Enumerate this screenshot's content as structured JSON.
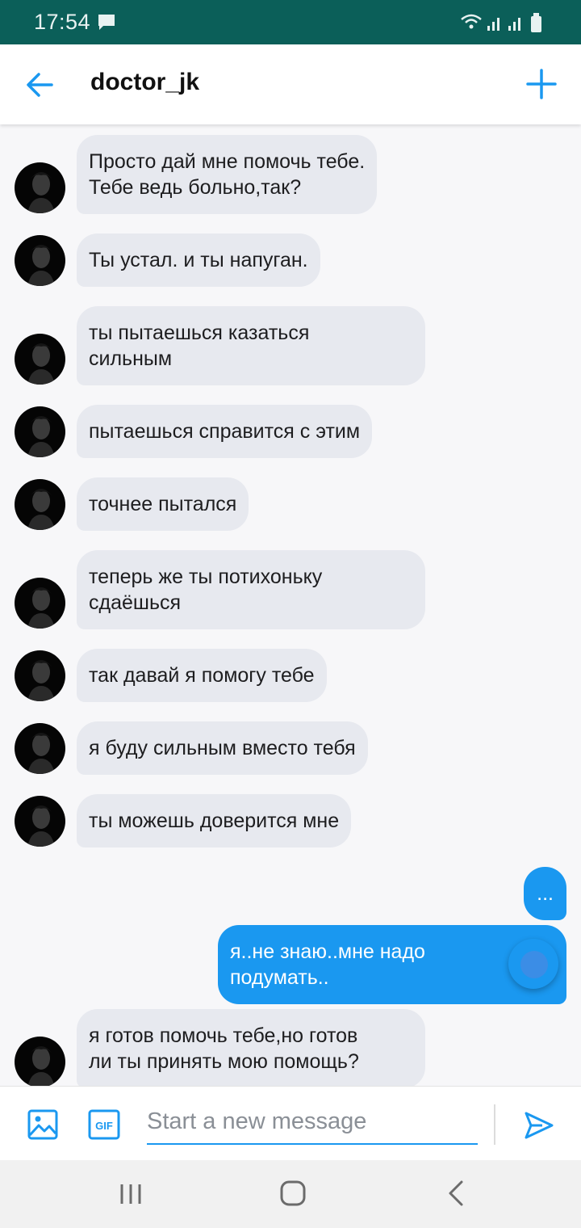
{
  "status_bar": {
    "time": "17:54"
  },
  "header": {
    "title": "doctor_jk"
  },
  "messages": [
    {
      "line1": "Просто дай мне помочь тебе.",
      "line2": "Тебе ведь больно,так?"
    },
    {
      "line1": "Ты устал. и ты напуган."
    },
    {
      "line1": "ты пытаешься казаться",
      "line2": "сильным"
    },
    {
      "line1": "пытаешься справится с этим"
    },
    {
      "line1": "точнее пытался"
    },
    {
      "line1": "теперь же ты потихоньку",
      "line2": "сдаёшься"
    },
    {
      "line1": "так давай я помогу тебе"
    },
    {
      "line1": "я буду сильным вместо тебя"
    },
    {
      "line1": "ты можешь доверится мне"
    },
    {
      "line1": "..."
    },
    {
      "line1": "я..не знаю..мне надо",
      "line2": "подумать.."
    },
    {
      "line1": "я готов помочь тебе,но готов",
      "line2": "ли ты принять мою помощь?"
    }
  ],
  "composer": {
    "placeholder": "Start a new message",
    "gif_label": "GIF"
  },
  "colors": {
    "accent": "#1a98f0",
    "status_bar": "#0b5f59",
    "incoming_bubble": "#e7e9ef"
  }
}
